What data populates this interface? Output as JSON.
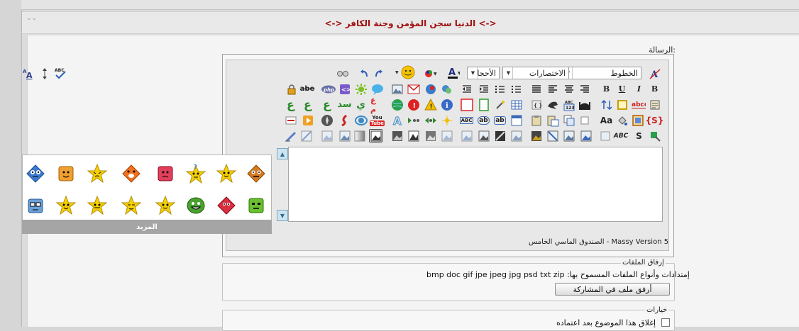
{
  "page": {
    "title": "<->   الدنيا سجن المؤمن وجنة الكافر  <->",
    "message_label": "الرسالة:",
    "version_text": "الصندوق الماسي الخامس - Massy Version 5"
  },
  "toolbar": {
    "fonts_select": "الخطوط",
    "shortcuts_select": "الاختصارات",
    "sizes_select": "الأحجا",
    "bold": "B",
    "italic": "I",
    "underline": "U",
    "bold2": "B",
    "strike": "abe",
    "abc": "ABC",
    "S": "S",
    "Aa": "Aa",
    "ab": "ab",
    "abc_red": "abcd",
    "you": "You",
    "tube": "Tube",
    "ar1": "ع",
    "ar2": "ع",
    "ar3": "ع",
    "ar4": "ي",
    "ar5": "سد",
    "ar6": "ع م",
    "php": "php",
    "abc_spell": "ABC"
  },
  "smilies": {
    "more_label": "المزيد"
  },
  "attach": {
    "legend": "إرفاق الملفات",
    "extensions_label": "إمتدادات وأنواع الملفات المسموح بها:",
    "extensions": "bmp doc gif jpe jpeg jpg psd txt zip",
    "button": "أرفق ملف في المشاركة"
  },
  "options": {
    "legend": "خيارات",
    "close_topic": "إغلاق هذا الموضوع بعد اعتماده"
  }
}
